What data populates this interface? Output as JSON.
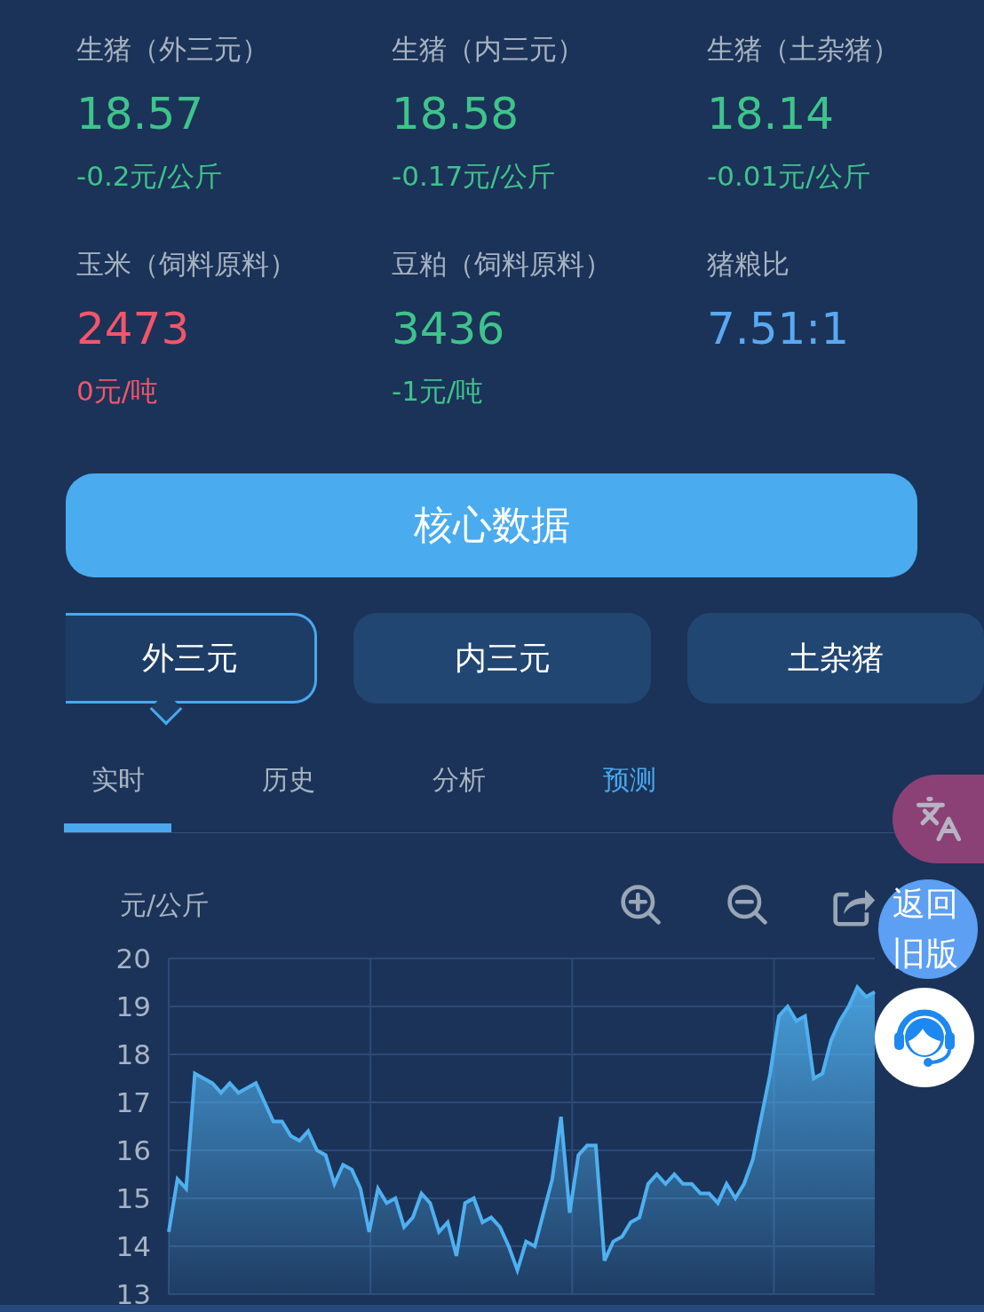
{
  "stats": [
    {
      "label": "生猪（外三元）",
      "value": "18.57",
      "change": "-0.2元/公斤",
      "color": "#3fc38b"
    },
    {
      "label": "生猪（内三元）",
      "value": "18.58",
      "change": "-0.17元/公斤",
      "color": "#3fc38b"
    },
    {
      "label": "生猪（土杂猪）",
      "value": "18.14",
      "change": "-0.01元/公斤",
      "color": "#3fc38b"
    },
    {
      "label": "玉米（饲料原料）",
      "value": "2473",
      "change": "0元/吨",
      "color": "#f2566a"
    },
    {
      "label": "豆粕（饲料原料）",
      "value": "3436",
      "change": "-1元/吨",
      "color": "#3fc38b"
    },
    {
      "label": "猪粮比",
      "value": "7.51:1",
      "color": "#5aa9f2"
    }
  ],
  "core_button": "核心数据",
  "breed_tabs": [
    {
      "label": "外三元",
      "selected": true
    },
    {
      "label": "内三元",
      "selected": false
    },
    {
      "label": "土杂猪",
      "selected": false
    }
  ],
  "view_tabs": [
    {
      "label": "实时",
      "selected": true,
      "highlighted": false
    },
    {
      "label": "历史",
      "selected": false,
      "highlighted": false
    },
    {
      "label": "分析",
      "selected": false,
      "highlighted": false
    },
    {
      "label": "预测",
      "selected": false,
      "highlighted": true
    }
  ],
  "chart": {
    "unit": "元/公斤",
    "chart_data": {
      "type": "area",
      "ylim": [
        13,
        20
      ],
      "yticks": [
        13,
        14,
        15,
        16,
        17,
        18,
        19,
        20
      ],
      "grid": true,
      "series": [
        {
          "color": "#4fb0f0",
          "values": [
            14.3,
            15.4,
            15.2,
            17.6,
            17.5,
            17.4,
            17.2,
            17.4,
            17.2,
            17.3,
            17.4,
            17.0,
            16.6,
            16.6,
            16.3,
            16.2,
            16.4,
            16.0,
            15.9,
            15.3,
            15.7,
            15.6,
            15.2,
            14.3,
            15.2,
            14.9,
            15.0,
            14.4,
            14.6,
            15.1,
            14.9,
            14.3,
            14.5,
            13.8,
            14.9,
            15.0,
            14.5,
            14.6,
            14.4,
            14.0,
            13.5,
            14.1,
            14.0,
            14.7,
            15.4,
            16.7,
            14.7,
            15.9,
            16.1,
            16.1,
            13.7,
            14.1,
            14.2,
            14.5,
            14.6,
            15.3,
            15.5,
            15.3,
            15.5,
            15.3,
            15.3,
            15.1,
            15.1,
            14.9,
            15.3,
            15.0,
            15.3,
            15.8,
            16.7,
            17.6,
            18.8,
            19.0,
            18.7,
            18.8,
            17.5,
            17.6,
            18.3,
            18.7,
            19.0,
            19.4,
            19.2,
            19.3
          ]
        }
      ]
    }
  },
  "float_buttons": {
    "old_version": "返回旧版"
  }
}
